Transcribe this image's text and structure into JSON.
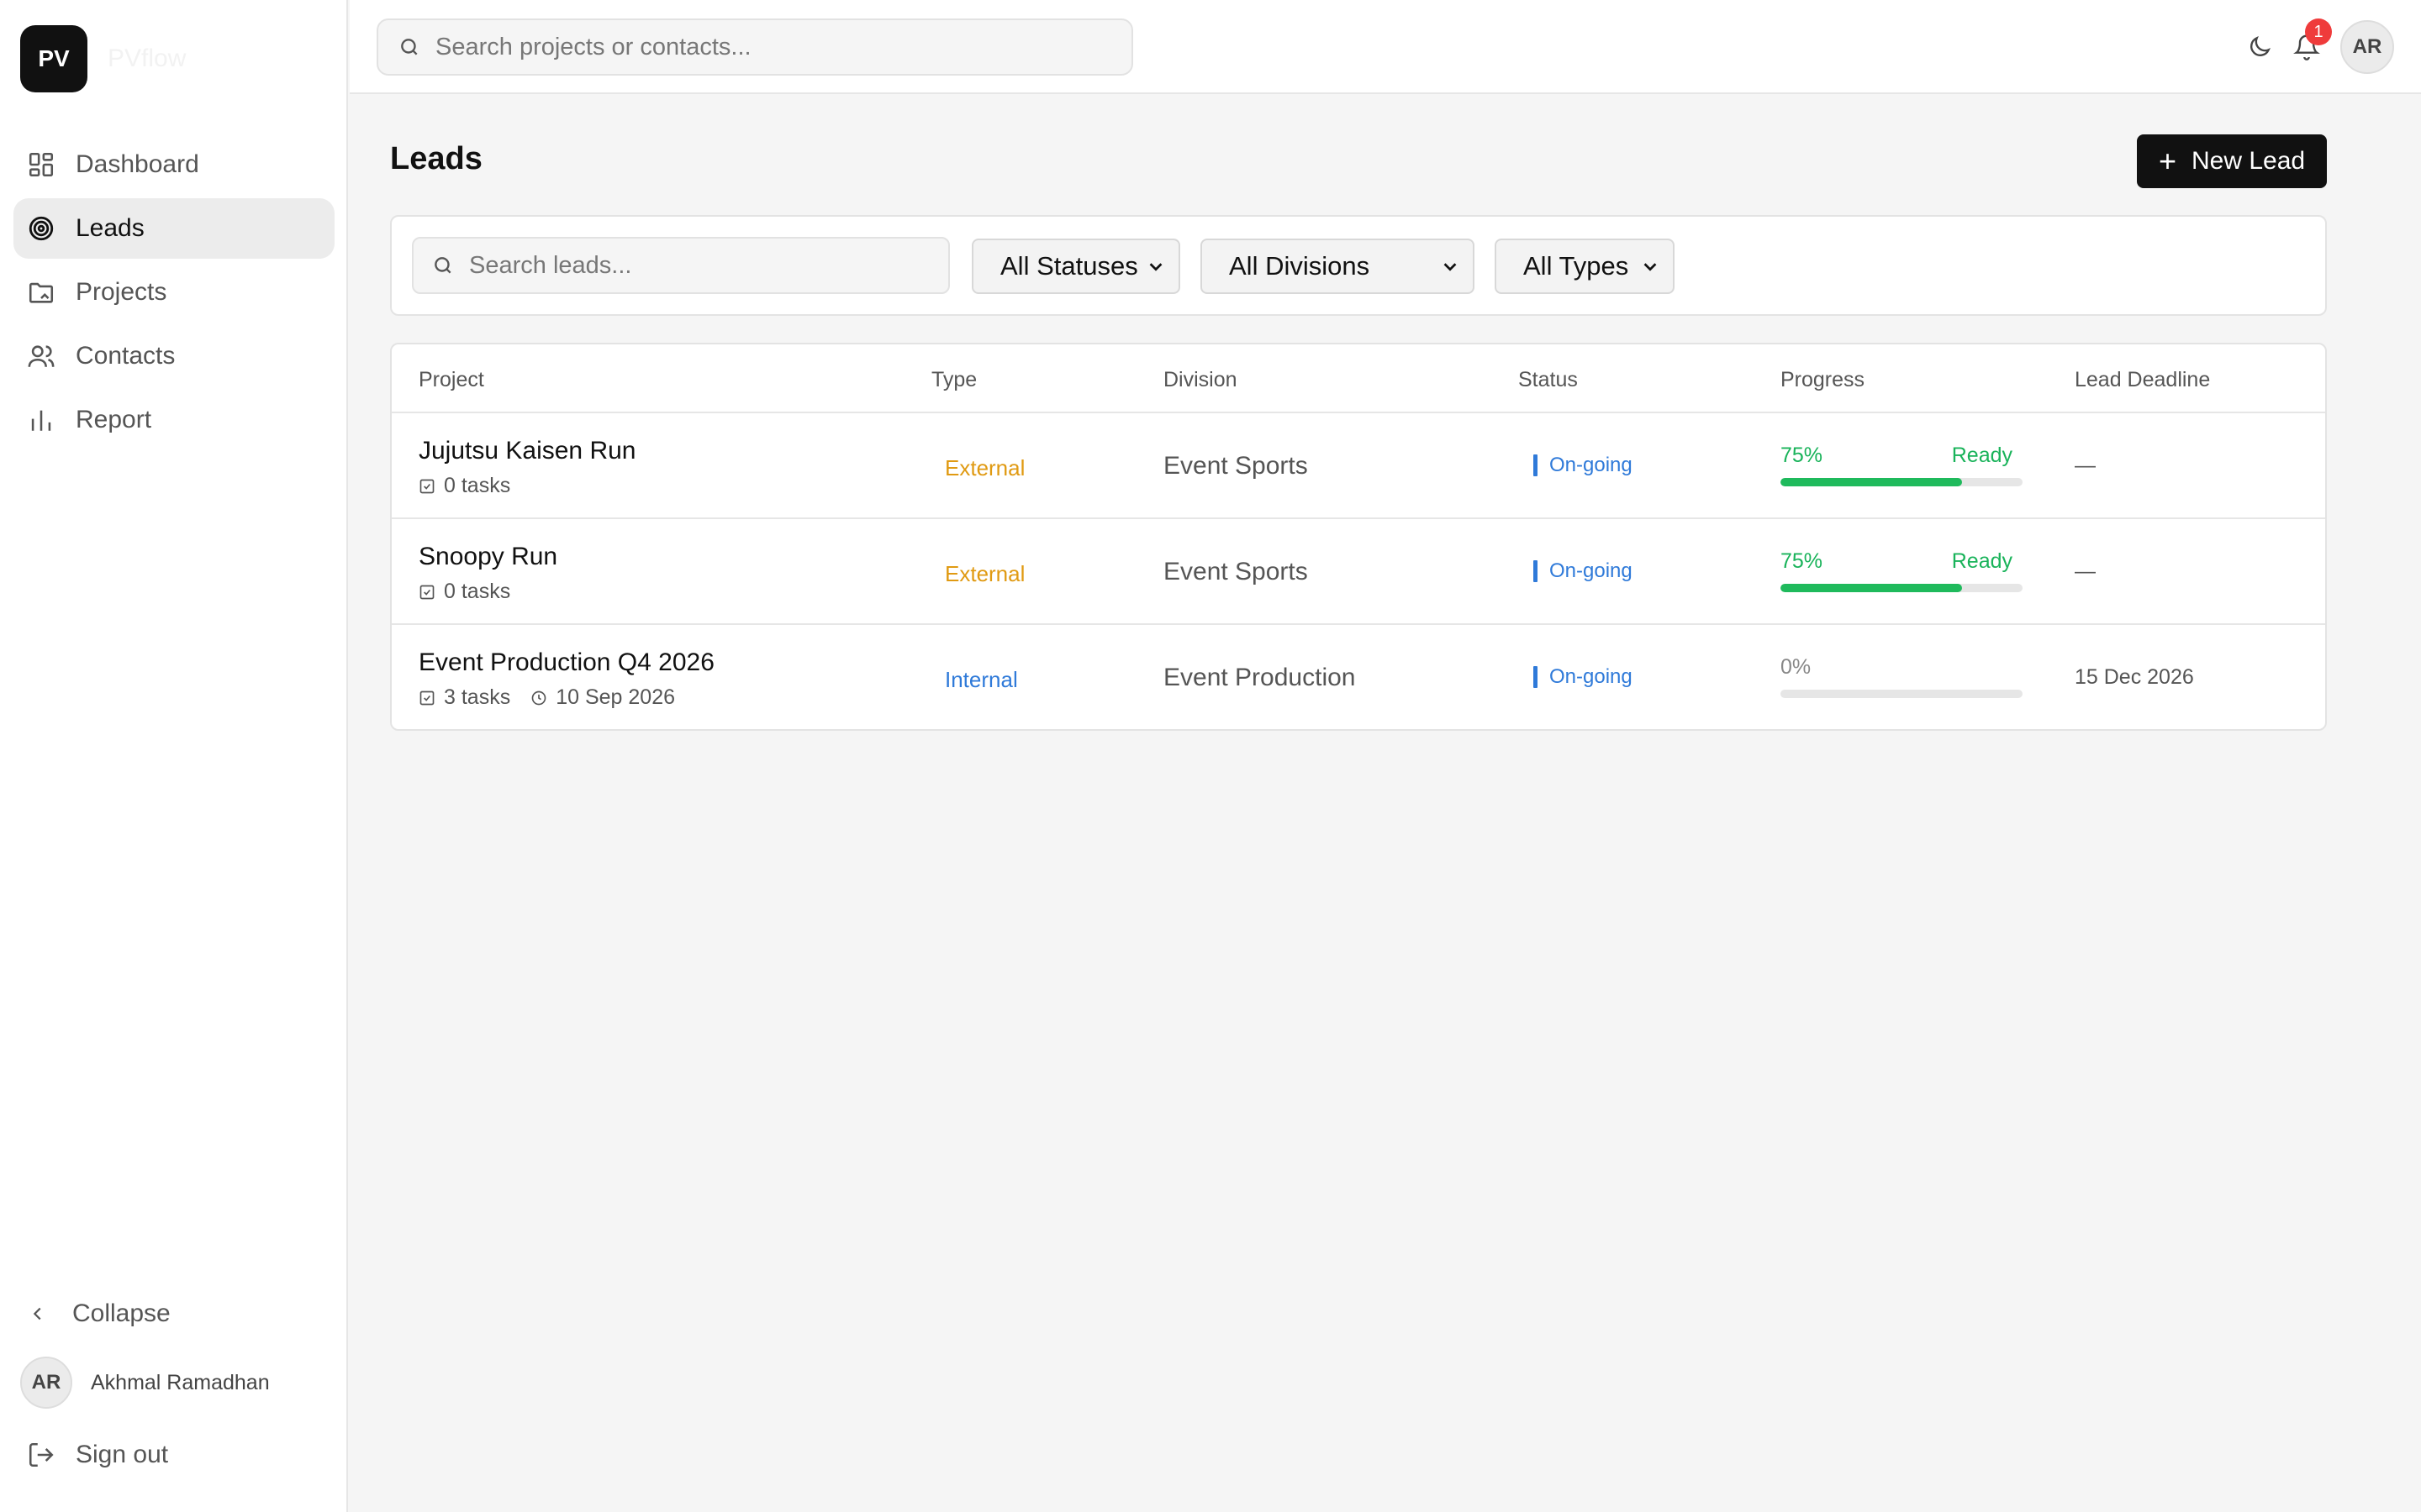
{
  "brand": {
    "logo_text": "PV",
    "name": "PVflow"
  },
  "sidebar": {
    "items": [
      {
        "label": "Dashboard",
        "icon": "dashboard-icon",
        "active": false
      },
      {
        "label": "Leads",
        "icon": "target-icon",
        "active": true
      },
      {
        "label": "Projects",
        "icon": "folder-icon",
        "active": false
      },
      {
        "label": "Contacts",
        "icon": "users-icon",
        "active": false
      },
      {
        "label": "Report",
        "icon": "bar-chart-icon",
        "active": false
      }
    ],
    "collapse_label": "Collapse",
    "user": {
      "initials": "AR",
      "name": "Akhmal Ramadhan"
    },
    "signout_label": "Sign out"
  },
  "topbar": {
    "search_placeholder": "Search projects or contacts...",
    "notification_count": "1",
    "avatar_initials": "AR"
  },
  "page": {
    "title": "Leads",
    "new_button_label": "New Lead",
    "filters": {
      "search_placeholder": "Search leads...",
      "status": "All Statuses",
      "division": "All Divisions",
      "type": "All Types"
    }
  },
  "table": {
    "columns": [
      "Project",
      "Type",
      "Division",
      "Status",
      "Progress",
      "Lead Deadline"
    ],
    "rows": [
      {
        "name": "Jujutsu Kaisen Run",
        "tasks": "0 tasks",
        "date": "",
        "type": "External",
        "division": "Event Sports",
        "status": "On-going",
        "progress_label": "75%",
        "progress": 0.75,
        "progress_state": "Ready",
        "deadline": "—"
      },
      {
        "name": "Snoopy Run",
        "tasks": "0 tasks",
        "date": "",
        "type": "External",
        "division": "Event Sports",
        "status": "On-going",
        "progress_label": "75%",
        "progress": 0.75,
        "progress_state": "Ready",
        "deadline": "—"
      },
      {
        "name": "Event Production Q4 2026",
        "tasks": "3 tasks",
        "date": "10 Sep 2026",
        "type": "Internal",
        "division": "Event Production",
        "status": "On-going",
        "progress_label": "0%",
        "progress": 0,
        "progress_state": "",
        "deadline": "15 Dec 2026"
      }
    ]
  },
  "colors": {
    "external": "#e09a12",
    "internal": "#2f7ad9",
    "progress": "#1fba5c",
    "accent_dark": "#111111",
    "badge": "#ef3b3b"
  }
}
